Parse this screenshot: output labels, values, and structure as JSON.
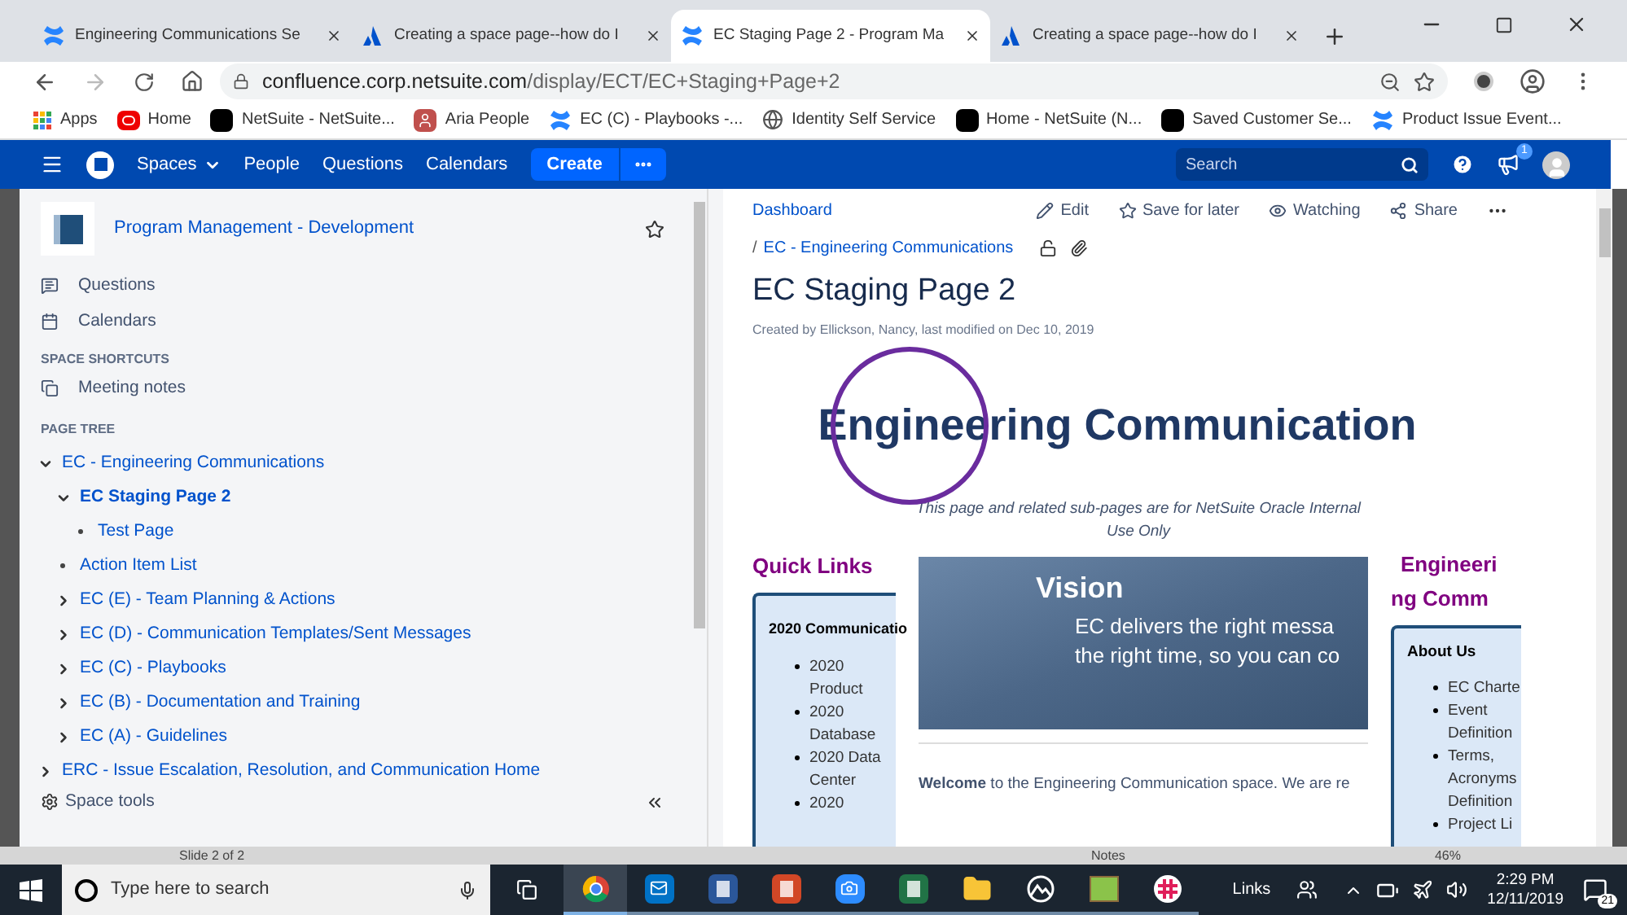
{
  "browser_tabs": [
    {
      "title": "Engineering Communications Se",
      "kind": "confluence",
      "selected": false
    },
    {
      "title": "Creating a space page--how do I",
      "kind": "atlassian",
      "selected": false
    },
    {
      "title": "EC Staging Page 2 - Program Ma",
      "kind": "confluence",
      "selected": true
    },
    {
      "title": "Creating a space page--how do I",
      "kind": "atlassian",
      "selected": false
    }
  ],
  "address": {
    "host": "confluence.corp.netsuite.com",
    "path": "/display/ECT/EC+Staging+Page+2"
  },
  "bookmarks": [
    {
      "label": "Apps",
      "kind": "apps"
    },
    {
      "label": "Home",
      "kind": "oracle"
    },
    {
      "label": "NetSuite - NetSuite...",
      "kind": "netsuite"
    },
    {
      "label": "Aria People",
      "kind": "person"
    },
    {
      "label": "EC (C) - Playbooks -...",
      "kind": "confluence"
    },
    {
      "label": "Identity Self Service",
      "kind": "globe"
    },
    {
      "label": "Home - NetSuite (N...",
      "kind": "netsuite"
    },
    {
      "label": "Saved Customer Se...",
      "kind": "netsuite"
    },
    {
      "label": "Product Issue Event...",
      "kind": "confluence"
    }
  ],
  "nav": {
    "items": [
      {
        "label": "Spaces",
        "dropdown": true
      },
      {
        "label": "People",
        "dropdown": false
      },
      {
        "label": "Questions",
        "dropdown": false
      },
      {
        "label": "Calendars",
        "dropdown": false
      }
    ],
    "create": "Create",
    "search": {
      "placeholder": "Search"
    },
    "notifications": "1"
  },
  "sidebar": {
    "space_name": "Program Management - Development",
    "items": [
      {
        "label": "Questions",
        "kind": "questions"
      },
      {
        "label": "Calendars",
        "kind": "calendar"
      }
    ],
    "shortcuts_heading": "SPACE SHORTCUTS",
    "shortcuts": [
      "Meeting notes"
    ],
    "tree_heading": "PAGE TREE",
    "tree": [
      {
        "label": "EC - Engineering Communications",
        "expanded": true,
        "selected": false,
        "children": [
          {
            "label": "EC Staging Page 2",
            "expanded": true,
            "selected": true,
            "children": [
              {
                "label": "Test Page",
                "selected": false
              }
            ]
          },
          {
            "label": "Action Item List",
            "selected": false
          },
          {
            "label": "EC (E) - Team Planning & Actions",
            "expanded": false,
            "selected": false
          },
          {
            "label": "EC (D) - Communication Templates/Sent Messages",
            "expanded": false,
            "selected": false
          },
          {
            "label": "EC (C) - Playbooks",
            "expanded": false,
            "selected": false
          },
          {
            "label": "EC (B) - Documentation and Training",
            "expanded": false,
            "selected": false
          },
          {
            "label": "EC (A) - Guidelines",
            "expanded": false,
            "selected": false
          }
        ]
      },
      {
        "label": "ERC - Issue Escalation, Resolution, and Communication Home",
        "expanded": false,
        "selected": false
      }
    ],
    "space_tools": "Space tools"
  },
  "page": {
    "breadcrumb": "Dashboard",
    "actions": [
      {
        "label": "Edit",
        "kind": "edit"
      },
      {
        "label": "Save for later",
        "kind": "star"
      },
      {
        "label": "Watching",
        "kind": "eye"
      },
      {
        "label": "Share",
        "kind": "share"
      }
    ],
    "parent_separator": "/",
    "parent": "EC - Engineering Communications",
    "title": "EC Staging Page 2",
    "byline": "Created by Ellickson, Nancy, last modified on Dec 10, 2019",
    "banner": "Engineering Communication",
    "notice": "This page and related sub-pages are for NetSuite Oracle Internal Use Only",
    "quick_links": {
      "heading": "Quick Links",
      "box_title": "2020 Communicatio",
      "items": [
        "2020 Product",
        "2020 Database",
        "2020 Data Center",
        "2020"
      ]
    },
    "vision": {
      "title": "Vision",
      "lines": [
        "EC delivers the right messa",
        "the right time, so you can co"
      ]
    },
    "welcome": "**Welcome** to the Engineering Communication space. We are re",
    "right_column": {
      "heading_lines": [
        "Engineeri",
        "ng Comm"
      ],
      "box_title": "About Us",
      "items": [
        "EC Charte",
        "Event Definition",
        "Terms, Acronyms Definition",
        "Project Li"
      ]
    }
  },
  "slide_strip": {
    "status": "Slide 2 of 2",
    "notes": "Notes",
    "zoom": "46%"
  },
  "taskbar": {
    "search_placeholder": "Type here to search",
    "apps": [
      {
        "kind": "chrome",
        "selected": true
      },
      {
        "kind": "outlook",
        "selected": false
      },
      {
        "kind": "word",
        "selected": false
      },
      {
        "kind": "powerpoint",
        "selected": false
      },
      {
        "kind": "zoom",
        "selected": false
      },
      {
        "kind": "excel",
        "selected": false
      },
      {
        "kind": "explorer",
        "selected": false
      },
      {
        "kind": "photos",
        "selected": false
      },
      {
        "kind": "paint",
        "selected": false
      },
      {
        "kind": "slack",
        "selected": false
      }
    ],
    "links": "Links",
    "time": "2:29 PM",
    "date": "12/11/2019",
    "notifications": "21"
  }
}
